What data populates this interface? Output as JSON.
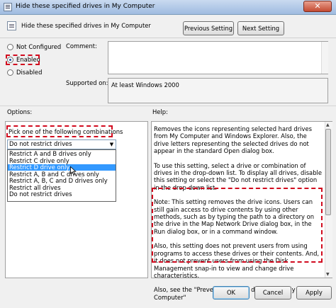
{
  "window": {
    "title": "Hide these specified drives in My Computer",
    "close_glyph": "✕"
  },
  "header": {
    "policy_title": "Hide these specified drives in My Computer",
    "prev_label": "Previous Setting",
    "next_label": "Next Setting"
  },
  "state": {
    "options": [
      {
        "label": "Not Configured",
        "selected": false
      },
      {
        "label": "Enabled",
        "selected": true
      },
      {
        "label": "Disabled",
        "selected": false
      }
    ]
  },
  "comment": {
    "label": "Comment:",
    "value": ""
  },
  "supported": {
    "label": "Supported on:",
    "value": "At least Windows 2000"
  },
  "options_panel": {
    "label": "Options:",
    "pick_text": "Pick one of the following combinations",
    "selected_value": "Do not restrict drives",
    "dropdown_items": [
      "Restrict A and B drives only",
      "Restrict C drive only",
      "Restrict D drive only",
      "Restrict A, B and C drives only",
      "Restrict A, B, C and D drives only",
      "Restrict all drives",
      "Do not restrict drives"
    ],
    "highlighted_index": 2
  },
  "help_panel": {
    "label": "Help:",
    "paragraphs": [
      "Removes the icons representing selected hard drives from My Computer and Windows Explorer. Also, the drive letters representing the selected drives do not appear in the standard Open dialog box.",
      "To use this setting, select a drive or combination of drives in the drop-down list. To display all drives, disable this setting or select the \"Do not restrict drives\" option in the drop-down list.",
      "Note: This setting removes the drive icons. Users can still gain access to drive contents by using other methods, such as by typing the path to a directory on the drive in the Map Network Drive dialog box, in the Run dialog box, or in a command window.",
      "Also, this setting does not prevent users from using programs to access these drives or their contents. And, it does not prevent users from using the Disk Management snap-in to view and change drive characteristics.",
      "Also, see the \"Prevent access to drives from My Computer\""
    ]
  },
  "footer": {
    "ok_label": "OK",
    "cancel_label": "Cancel",
    "apply_label": "Apply"
  },
  "colors": {
    "annotation_red": "#d10a1e",
    "selection_blue": "#3399ff"
  }
}
